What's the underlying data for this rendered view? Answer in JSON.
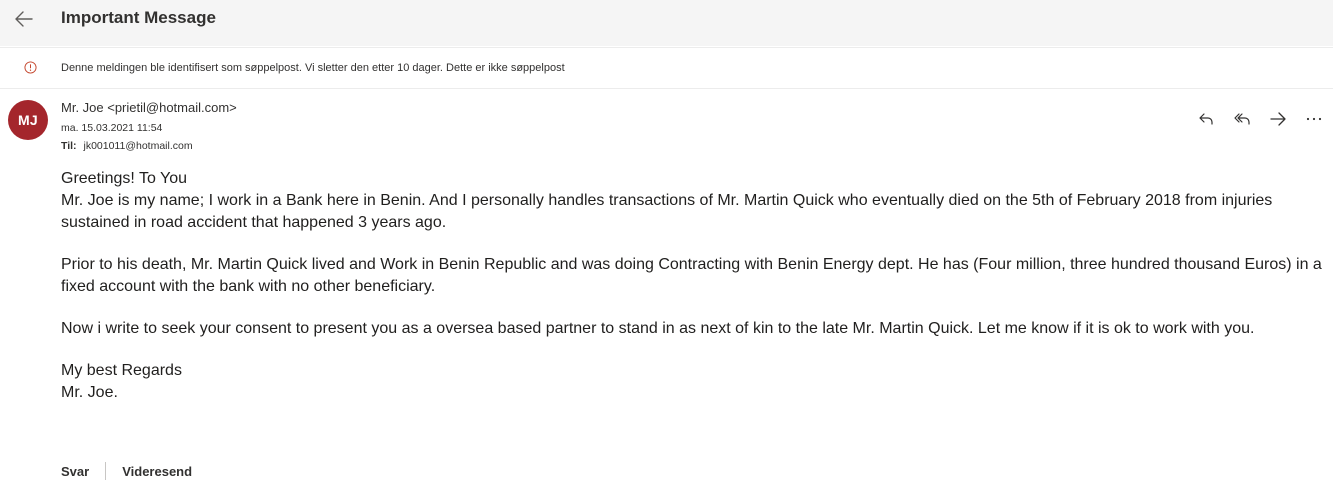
{
  "header": {
    "subject": "Important Message",
    "back_icon": "arrow-left-icon"
  },
  "banner": {
    "icon": "info-icon",
    "text": "Denne meldingen ble identifisert som søppelpost. Vi sletter den etter 10 dager.",
    "link": "Dette er ikke søppelpost"
  },
  "message": {
    "avatar_initials": "MJ",
    "avatar_color": "#a4262c",
    "from": "Mr. Joe <prietil@hotmail.com>",
    "date": "ma. 15.03.2021 11:54",
    "to_label": "Til:",
    "to": "jk001011@hotmail.com",
    "actions": [
      {
        "name": "reply",
        "icon": "reply-icon"
      },
      {
        "name": "reply-all",
        "icon": "reply-all-icon"
      },
      {
        "name": "forward",
        "icon": "forward-icon"
      },
      {
        "name": "more",
        "icon": "more-icon"
      }
    ],
    "body": {
      "greeting": "Greetings! To You",
      "p1": "Mr. Joe is my name; I work in a Bank here in Benin. And I personally handles transactions of Mr. Martin Quick who eventually died on the 5th of February 2018 from injuries sustained in road accident that happened 3 years ago.",
      "p2": "Prior to his death, Mr. Martin Quick lived and Work in Benin Republic and was doing Contracting with Benin Energy dept. He has (Four million, three hundred thousand Euros) in a fixed account with the bank with no other beneficiary.",
      "p3": "Now i write to seek your consent to present you as a oversea based partner to stand in as next of kin to the late Mr. Martin Quick. Let me know if it is ok to work with you.",
      "closing": "My best Regards",
      "signature": "Mr. Joe."
    }
  },
  "footer": {
    "reply_label": "Svar",
    "forward_label": "Videresend"
  }
}
